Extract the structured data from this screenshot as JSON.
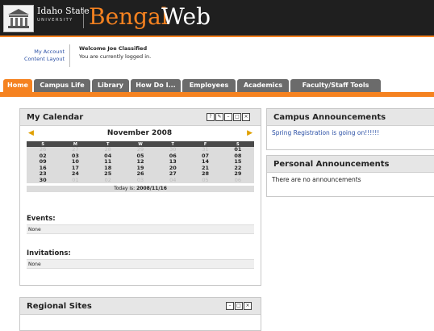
{
  "header": {
    "university_name": "Idaho State",
    "university_sub": "UNIVERSITY",
    "brand_part1": "Bengal",
    "brand_part2": "Web",
    "accent": "#f58220"
  },
  "user": {
    "my_account": "My Account",
    "content_layout": "Content Layout",
    "welcome": "Welcome Joe Classified",
    "status": "You are currently logged in."
  },
  "tabs": [
    {
      "label": "Home",
      "active": true
    },
    {
      "label": "Campus Life",
      "active": false
    },
    {
      "label": "Library",
      "active": false
    },
    {
      "label": "How Do I...",
      "active": false
    },
    {
      "label": "Employees",
      "active": false
    },
    {
      "label": "Academics",
      "active": false
    },
    {
      "label": "Faculty/Staff Tools",
      "active": false
    }
  ],
  "calendar": {
    "title": "My Calendar",
    "month": "November 2008",
    "weekdays": [
      "S",
      "M",
      "T",
      "W",
      "T",
      "F",
      "S"
    ],
    "weeks": [
      [
        "26",
        "27",
        "28",
        "29",
        "30",
        "31",
        "01"
      ],
      [
        "02",
        "03",
        "04",
        "05",
        "06",
        "07",
        "08"
      ],
      [
        "09",
        "10",
        "11",
        "12",
        "13",
        "14",
        "15"
      ],
      [
        "16",
        "17",
        "18",
        "19",
        "20",
        "21",
        "22"
      ],
      [
        "23",
        "24",
        "25",
        "26",
        "27",
        "28",
        "29"
      ],
      [
        "30",
        "01",
        "02",
        "03",
        "04",
        "05",
        "06"
      ]
    ],
    "today_label": "Today is:",
    "today_value": "2008/11/16",
    "events_label": "Events:",
    "events_value": "None",
    "invitations_label": "Invitations:",
    "invitations_value": "None"
  },
  "regional": {
    "title": "Regional Sites"
  },
  "campus_announcements": {
    "title": "Campus Announcements",
    "item": "Spring Registration is going on!!!!!!"
  },
  "personal_announcements": {
    "title": "Personal Announcements",
    "item": "There are no announcements"
  }
}
